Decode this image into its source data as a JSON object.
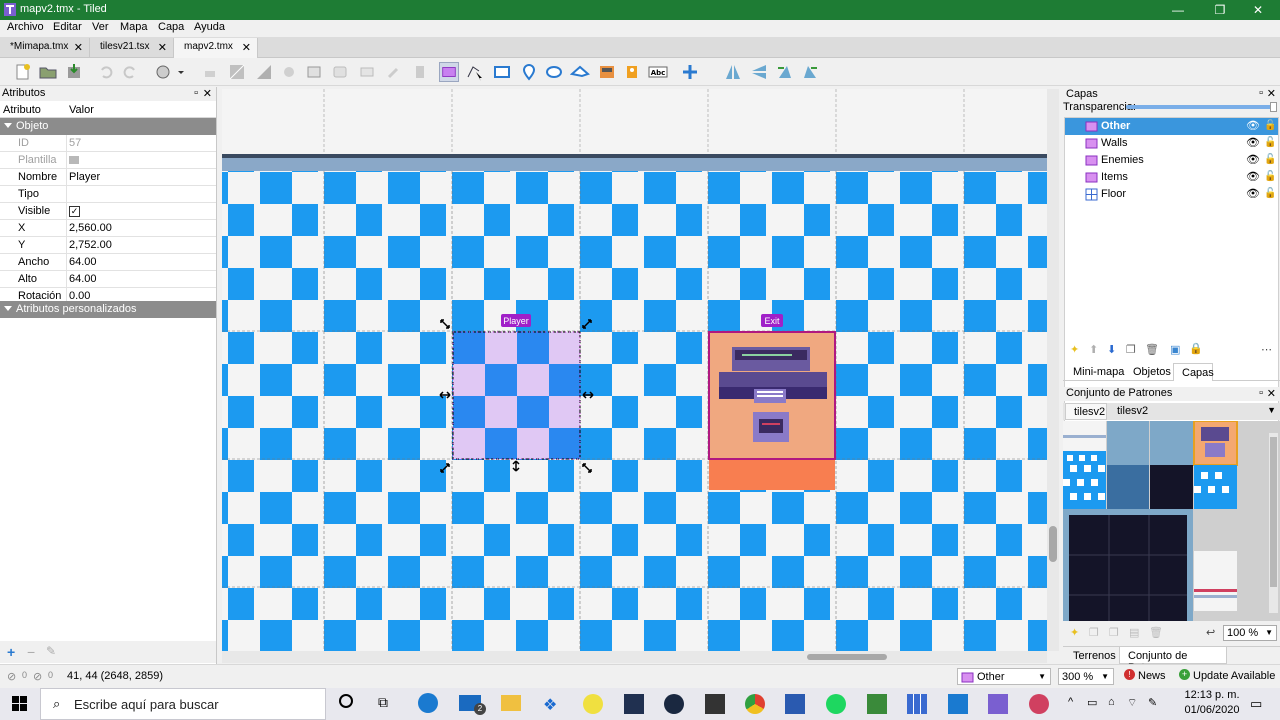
{
  "window": {
    "title": "mapv2.tmx - Tiled",
    "minimize": "—",
    "maximize": "❐",
    "close": "✕"
  },
  "menu": [
    "Archivo",
    "Editar",
    "Ver",
    "Mapa",
    "Capa",
    "Ayuda"
  ],
  "tabs": [
    {
      "label": "*Mimapa.tmx",
      "close": "✕"
    },
    {
      "label": "tilesv21.tsx",
      "close": "✕"
    },
    {
      "label": "mapv2.tmx",
      "close": "✕"
    }
  ],
  "toolbar_icons": [
    "new-icon",
    "open-icon",
    "save-icon",
    "undo-icon",
    "redo-icon",
    "stamp-icon",
    "terrain-icon",
    "fill-icon",
    "eraser-icon",
    "rect-select-icon",
    "magic-wand-icon",
    "select-same-icon",
    "select-objects-icon",
    "edit-polygons-icon",
    "insert-rectangle-icon",
    "insert-point-icon",
    "insert-ellipse-icon",
    "insert-polygon-icon",
    "insert-tile-icon",
    "insert-template-icon",
    "insert-text-icon",
    "move-icon",
    "flip-h-icon",
    "flip-v-icon",
    "rotate-left-icon",
    "rotate-right-icon"
  ],
  "properties": {
    "panel_title": "Atributos",
    "col_name": "Atributo",
    "col_value": "Valor",
    "group_object": "Objeto",
    "rows": [
      {
        "key": "ID",
        "value": "57"
      },
      {
        "key": "Plantilla",
        "value": ""
      },
      {
        "key": "Nombre",
        "value": "Player"
      },
      {
        "key": "Tipo",
        "value": ""
      },
      {
        "key": "Visible",
        "value": "✓"
      },
      {
        "key": "X",
        "value": "2,560.00"
      },
      {
        "key": "Y",
        "value": "2,752.00"
      },
      {
        "key": "Ancho",
        "value": "64.00"
      },
      {
        "key": "Alto",
        "value": "64.00"
      },
      {
        "key": "Rotación",
        "value": "0.00"
      }
    ],
    "group_custom": "Atributos personalizados"
  },
  "map_objects": {
    "player_label": "Player",
    "exit_label": "Exit"
  },
  "layers_panel": {
    "title": "Capas",
    "opacity_label": "Transparencia:",
    "opacity": 1.0,
    "layers": [
      {
        "name": "Other",
        "selected": true
      },
      {
        "name": "Walls",
        "selected": false
      },
      {
        "name": "Enemies",
        "selected": false
      },
      {
        "name": "Items",
        "selected": false
      },
      {
        "name": "Floor",
        "selected": false
      }
    ],
    "tabs": [
      "Mini-mapa",
      "Objetos",
      "Capas"
    ]
  },
  "tileset_panel": {
    "title": "Conjunto de Patrones",
    "tabs": [
      "tilesv2",
      "tilesv2"
    ],
    "zoom": "100 %",
    "bottom_tabs": [
      "Terrenos",
      "Conjunto de Patrones"
    ]
  },
  "statusbar": {
    "warn_count": "0",
    "err_count": "0",
    "coords": "41, 44 (2648, 2859)",
    "layer_select": "Other",
    "zoom": "300 %",
    "news": "News",
    "update": "Update Available"
  },
  "taskbar": {
    "search_placeholder": "Escribe aquí para buscar",
    "time": "12:13 p. m.",
    "date": "01/06/2020",
    "mail_badge": "2"
  },
  "colors": {
    "titlebar": "#1e7c34",
    "checker_blue": "#1c9af0",
    "checker_light": "#f4f4f4",
    "selection": "#3a96dd",
    "object_label": "#a020c8"
  }
}
